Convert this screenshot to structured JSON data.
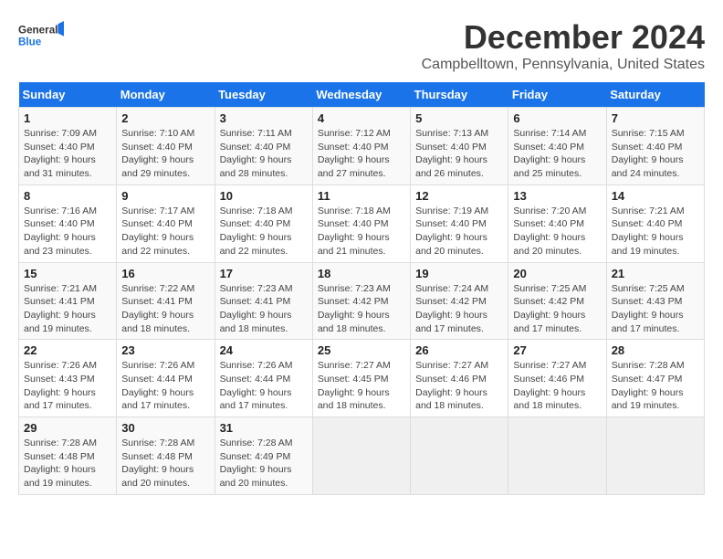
{
  "logo": {
    "line1": "General",
    "line2": "Blue"
  },
  "title": "December 2024",
  "subtitle": "Campbelltown, Pennsylvania, United States",
  "days_of_week": [
    "Sunday",
    "Monday",
    "Tuesday",
    "Wednesday",
    "Thursday",
    "Friday",
    "Saturday"
  ],
  "weeks": [
    [
      {
        "day": "1",
        "sunrise": "7:09 AM",
        "sunset": "4:40 PM",
        "daylight": "9 hours and 31 minutes."
      },
      {
        "day": "2",
        "sunrise": "7:10 AM",
        "sunset": "4:40 PM",
        "daylight": "9 hours and 29 minutes."
      },
      {
        "day": "3",
        "sunrise": "7:11 AM",
        "sunset": "4:40 PM",
        "daylight": "9 hours and 28 minutes."
      },
      {
        "day": "4",
        "sunrise": "7:12 AM",
        "sunset": "4:40 PM",
        "daylight": "9 hours and 27 minutes."
      },
      {
        "day": "5",
        "sunrise": "7:13 AM",
        "sunset": "4:40 PM",
        "daylight": "9 hours and 26 minutes."
      },
      {
        "day": "6",
        "sunrise": "7:14 AM",
        "sunset": "4:40 PM",
        "daylight": "9 hours and 25 minutes."
      },
      {
        "day": "7",
        "sunrise": "7:15 AM",
        "sunset": "4:40 PM",
        "daylight": "9 hours and 24 minutes."
      }
    ],
    [
      {
        "day": "8",
        "sunrise": "7:16 AM",
        "sunset": "4:40 PM",
        "daylight": "9 hours and 23 minutes."
      },
      {
        "day": "9",
        "sunrise": "7:17 AM",
        "sunset": "4:40 PM",
        "daylight": "9 hours and 22 minutes."
      },
      {
        "day": "10",
        "sunrise": "7:18 AM",
        "sunset": "4:40 PM",
        "daylight": "9 hours and 22 minutes."
      },
      {
        "day": "11",
        "sunrise": "7:18 AM",
        "sunset": "4:40 PM",
        "daylight": "9 hours and 21 minutes."
      },
      {
        "day": "12",
        "sunrise": "7:19 AM",
        "sunset": "4:40 PM",
        "daylight": "9 hours and 20 minutes."
      },
      {
        "day": "13",
        "sunrise": "7:20 AM",
        "sunset": "4:40 PM",
        "daylight": "9 hours and 20 minutes."
      },
      {
        "day": "14",
        "sunrise": "7:21 AM",
        "sunset": "4:40 PM",
        "daylight": "9 hours and 19 minutes."
      }
    ],
    [
      {
        "day": "15",
        "sunrise": "7:21 AM",
        "sunset": "4:41 PM",
        "daylight": "9 hours and 19 minutes."
      },
      {
        "day": "16",
        "sunrise": "7:22 AM",
        "sunset": "4:41 PM",
        "daylight": "9 hours and 18 minutes."
      },
      {
        "day": "17",
        "sunrise": "7:23 AM",
        "sunset": "4:41 PM",
        "daylight": "9 hours and 18 minutes."
      },
      {
        "day": "18",
        "sunrise": "7:23 AM",
        "sunset": "4:42 PM",
        "daylight": "9 hours and 18 minutes."
      },
      {
        "day": "19",
        "sunrise": "7:24 AM",
        "sunset": "4:42 PM",
        "daylight": "9 hours and 17 minutes."
      },
      {
        "day": "20",
        "sunrise": "7:25 AM",
        "sunset": "4:42 PM",
        "daylight": "9 hours and 17 minutes."
      },
      {
        "day": "21",
        "sunrise": "7:25 AM",
        "sunset": "4:43 PM",
        "daylight": "9 hours and 17 minutes."
      }
    ],
    [
      {
        "day": "22",
        "sunrise": "7:26 AM",
        "sunset": "4:43 PM",
        "daylight": "9 hours and 17 minutes."
      },
      {
        "day": "23",
        "sunrise": "7:26 AM",
        "sunset": "4:44 PM",
        "daylight": "9 hours and 17 minutes."
      },
      {
        "day": "24",
        "sunrise": "7:26 AM",
        "sunset": "4:44 PM",
        "daylight": "9 hours and 17 minutes."
      },
      {
        "day": "25",
        "sunrise": "7:27 AM",
        "sunset": "4:45 PM",
        "daylight": "9 hours and 18 minutes."
      },
      {
        "day": "26",
        "sunrise": "7:27 AM",
        "sunset": "4:46 PM",
        "daylight": "9 hours and 18 minutes."
      },
      {
        "day": "27",
        "sunrise": "7:27 AM",
        "sunset": "4:46 PM",
        "daylight": "9 hours and 18 minutes."
      },
      {
        "day": "28",
        "sunrise": "7:28 AM",
        "sunset": "4:47 PM",
        "daylight": "9 hours and 19 minutes."
      }
    ],
    [
      {
        "day": "29",
        "sunrise": "7:28 AM",
        "sunset": "4:48 PM",
        "daylight": "9 hours and 19 minutes."
      },
      {
        "day": "30",
        "sunrise": "7:28 AM",
        "sunset": "4:48 PM",
        "daylight": "9 hours and 20 minutes."
      },
      {
        "day": "31",
        "sunrise": "7:28 AM",
        "sunset": "4:49 PM",
        "daylight": "9 hours and 20 minutes."
      },
      null,
      null,
      null,
      null
    ]
  ],
  "labels": {
    "sunrise": "Sunrise:",
    "sunset": "Sunset:",
    "daylight": "Daylight:"
  }
}
